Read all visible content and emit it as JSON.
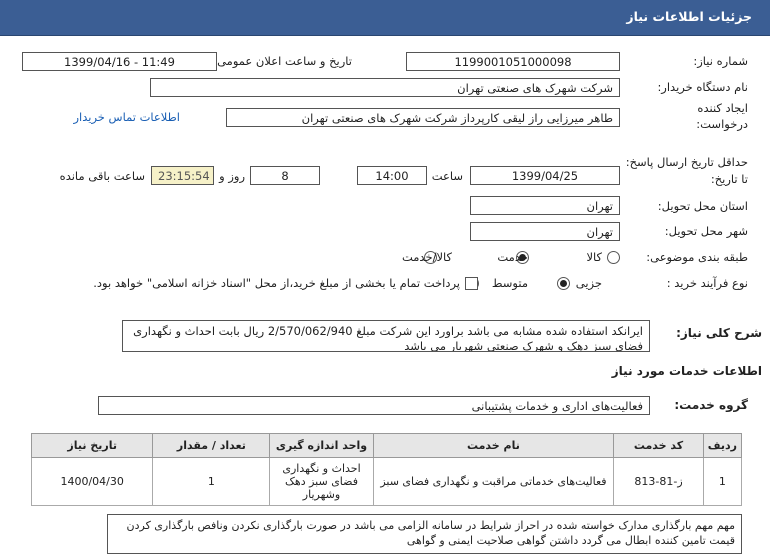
{
  "title": "جزئیات اطلاعات نیاز",
  "fields": {
    "need_number_label": "شماره نیاز:",
    "need_number": "1199001051000098",
    "announce_label": "تاریخ و ساعت اعلان عمومی:",
    "announce_value": "1399/04/16 - 11:49",
    "buyer_label": "نام دستگاه خریدار:",
    "buyer_value": "شرکت شهرک های صنعتی تهران",
    "creator_label_1": "ایجاد کننده",
    "creator_label_2": "درخواست:",
    "creator_value": "طاهر  میرزایی راز لیقی کارپرداز  شرکت شهرک های صنعتی تهران",
    "contact_link": "اطلاعات تماس خریدار",
    "deadline_label_1": "حداقل تاریخ ارسال پاسخ:",
    "deadline_label_2": "تا تاریخ:",
    "deadline_date": "1399/04/25",
    "time_label": "ساعت",
    "deadline_time": "14:00",
    "days_value": "8",
    "days_label": "روز و",
    "remaining_time": "23:15:54",
    "remaining_label": "ساعت باقی مانده",
    "province_label": "استان محل تحویل:",
    "province_value": "تهران",
    "city_label": "شهر محل تحویل:",
    "city_value": "تهران",
    "category_label": "طبقه بندی موضوعی:",
    "category_options": [
      "کالا",
      "خدمت",
      "کالا/خدمت"
    ],
    "process_label": "نوع فرآیند خرید :",
    "process_options": [
      "جزیی",
      "متوسط"
    ],
    "payment_note": "پرداخت تمام یا بخشی از مبلغ خرید،از محل \"اسناد خزانه اسلامی\" خواهد بود."
  },
  "description": {
    "label": "شرح کلی نیاز:",
    "text": "ایرانکد استفاده شده مشابه می باشد براورد این شرکت مبلغ 2/570/062/940 ریال بابت احداث و نگهداری فضای سبز دهک و شهرک صنعتی شهریار می باشد"
  },
  "services_title": "اطلاعات خدمات مورد نیاز",
  "service_group": {
    "label": "گروه خدمت:",
    "value": "فعالیت‌های اداری و خدمات پشتیبانی"
  },
  "table": {
    "headers": [
      "ردیف",
      "کد خدمت",
      "نام خدمت",
      "واحد اندازه گیری",
      "تعداد / مقدار",
      "تاریخ نیاز"
    ],
    "rows": [
      {
        "index": "1",
        "code": "ز-81-813",
        "name": "فعالیت‌های خدماتی مراقبت و نگهداری فضای سبز",
        "unit": "احداث و نگهداری فضای سبز دهک وشهریار",
        "qty": "1",
        "date": "1400/04/30"
      }
    ]
  },
  "note": {
    "text": "مهم مهم بارگذاری مدارک خواسته شده در احراز شرایط در سامانه الزامی می باشد در صورت بارگذاری نکردن ونافص بارگذاری کردن قیمت تامین کننده ابطال می گردد داشتن گواهی صلاحیت ایمنی و گواهی"
  }
}
